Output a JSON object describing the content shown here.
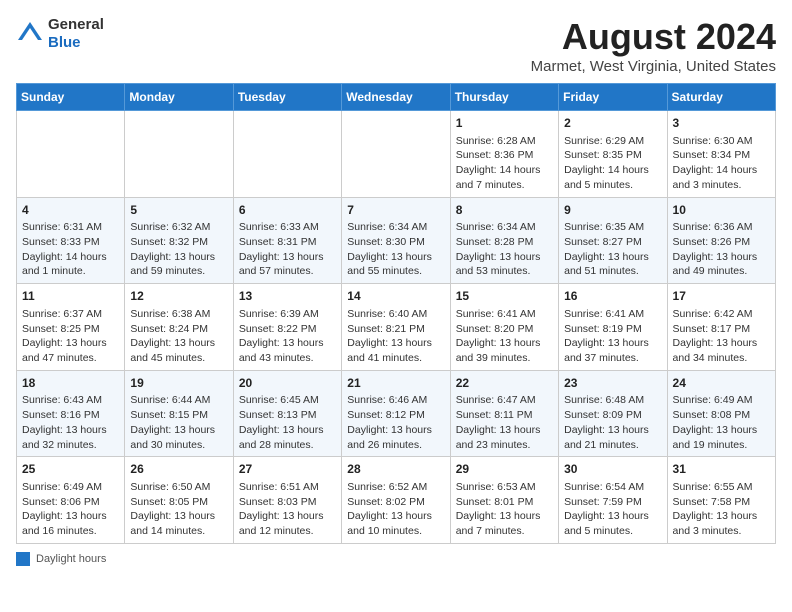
{
  "header": {
    "logo_line1": "General",
    "logo_line2": "Blue",
    "title": "August 2024",
    "location": "Marmet, West Virginia, United States"
  },
  "days_of_week": [
    "Sunday",
    "Monday",
    "Tuesday",
    "Wednesday",
    "Thursday",
    "Friday",
    "Saturday"
  ],
  "weeks": [
    [
      {
        "day": "",
        "info": ""
      },
      {
        "day": "",
        "info": ""
      },
      {
        "day": "",
        "info": ""
      },
      {
        "day": "",
        "info": ""
      },
      {
        "day": "1",
        "info": "Sunrise: 6:28 AM\nSunset: 8:36 PM\nDaylight: 14 hours and 7 minutes."
      },
      {
        "day": "2",
        "info": "Sunrise: 6:29 AM\nSunset: 8:35 PM\nDaylight: 14 hours and 5 minutes."
      },
      {
        "day": "3",
        "info": "Sunrise: 6:30 AM\nSunset: 8:34 PM\nDaylight: 14 hours and 3 minutes."
      }
    ],
    [
      {
        "day": "4",
        "info": "Sunrise: 6:31 AM\nSunset: 8:33 PM\nDaylight: 14 hours and 1 minute."
      },
      {
        "day": "5",
        "info": "Sunrise: 6:32 AM\nSunset: 8:32 PM\nDaylight: 13 hours and 59 minutes."
      },
      {
        "day": "6",
        "info": "Sunrise: 6:33 AM\nSunset: 8:31 PM\nDaylight: 13 hours and 57 minutes."
      },
      {
        "day": "7",
        "info": "Sunrise: 6:34 AM\nSunset: 8:30 PM\nDaylight: 13 hours and 55 minutes."
      },
      {
        "day": "8",
        "info": "Sunrise: 6:34 AM\nSunset: 8:28 PM\nDaylight: 13 hours and 53 minutes."
      },
      {
        "day": "9",
        "info": "Sunrise: 6:35 AM\nSunset: 8:27 PM\nDaylight: 13 hours and 51 minutes."
      },
      {
        "day": "10",
        "info": "Sunrise: 6:36 AM\nSunset: 8:26 PM\nDaylight: 13 hours and 49 minutes."
      }
    ],
    [
      {
        "day": "11",
        "info": "Sunrise: 6:37 AM\nSunset: 8:25 PM\nDaylight: 13 hours and 47 minutes."
      },
      {
        "day": "12",
        "info": "Sunrise: 6:38 AM\nSunset: 8:24 PM\nDaylight: 13 hours and 45 minutes."
      },
      {
        "day": "13",
        "info": "Sunrise: 6:39 AM\nSunset: 8:22 PM\nDaylight: 13 hours and 43 minutes."
      },
      {
        "day": "14",
        "info": "Sunrise: 6:40 AM\nSunset: 8:21 PM\nDaylight: 13 hours and 41 minutes."
      },
      {
        "day": "15",
        "info": "Sunrise: 6:41 AM\nSunset: 8:20 PM\nDaylight: 13 hours and 39 minutes."
      },
      {
        "day": "16",
        "info": "Sunrise: 6:41 AM\nSunset: 8:19 PM\nDaylight: 13 hours and 37 minutes."
      },
      {
        "day": "17",
        "info": "Sunrise: 6:42 AM\nSunset: 8:17 PM\nDaylight: 13 hours and 34 minutes."
      }
    ],
    [
      {
        "day": "18",
        "info": "Sunrise: 6:43 AM\nSunset: 8:16 PM\nDaylight: 13 hours and 32 minutes."
      },
      {
        "day": "19",
        "info": "Sunrise: 6:44 AM\nSunset: 8:15 PM\nDaylight: 13 hours and 30 minutes."
      },
      {
        "day": "20",
        "info": "Sunrise: 6:45 AM\nSunset: 8:13 PM\nDaylight: 13 hours and 28 minutes."
      },
      {
        "day": "21",
        "info": "Sunrise: 6:46 AM\nSunset: 8:12 PM\nDaylight: 13 hours and 26 minutes."
      },
      {
        "day": "22",
        "info": "Sunrise: 6:47 AM\nSunset: 8:11 PM\nDaylight: 13 hours and 23 minutes."
      },
      {
        "day": "23",
        "info": "Sunrise: 6:48 AM\nSunset: 8:09 PM\nDaylight: 13 hours and 21 minutes."
      },
      {
        "day": "24",
        "info": "Sunrise: 6:49 AM\nSunset: 8:08 PM\nDaylight: 13 hours and 19 minutes."
      }
    ],
    [
      {
        "day": "25",
        "info": "Sunrise: 6:49 AM\nSunset: 8:06 PM\nDaylight: 13 hours and 16 minutes."
      },
      {
        "day": "26",
        "info": "Sunrise: 6:50 AM\nSunset: 8:05 PM\nDaylight: 13 hours and 14 minutes."
      },
      {
        "day": "27",
        "info": "Sunrise: 6:51 AM\nSunset: 8:03 PM\nDaylight: 13 hours and 12 minutes."
      },
      {
        "day": "28",
        "info": "Sunrise: 6:52 AM\nSunset: 8:02 PM\nDaylight: 13 hours and 10 minutes."
      },
      {
        "day": "29",
        "info": "Sunrise: 6:53 AM\nSunset: 8:01 PM\nDaylight: 13 hours and 7 minutes."
      },
      {
        "day": "30",
        "info": "Sunrise: 6:54 AM\nSunset: 7:59 PM\nDaylight: 13 hours and 5 minutes."
      },
      {
        "day": "31",
        "info": "Sunrise: 6:55 AM\nSunset: 7:58 PM\nDaylight: 13 hours and 3 minutes."
      }
    ]
  ],
  "footer": {
    "legend_label": "Daylight hours"
  }
}
